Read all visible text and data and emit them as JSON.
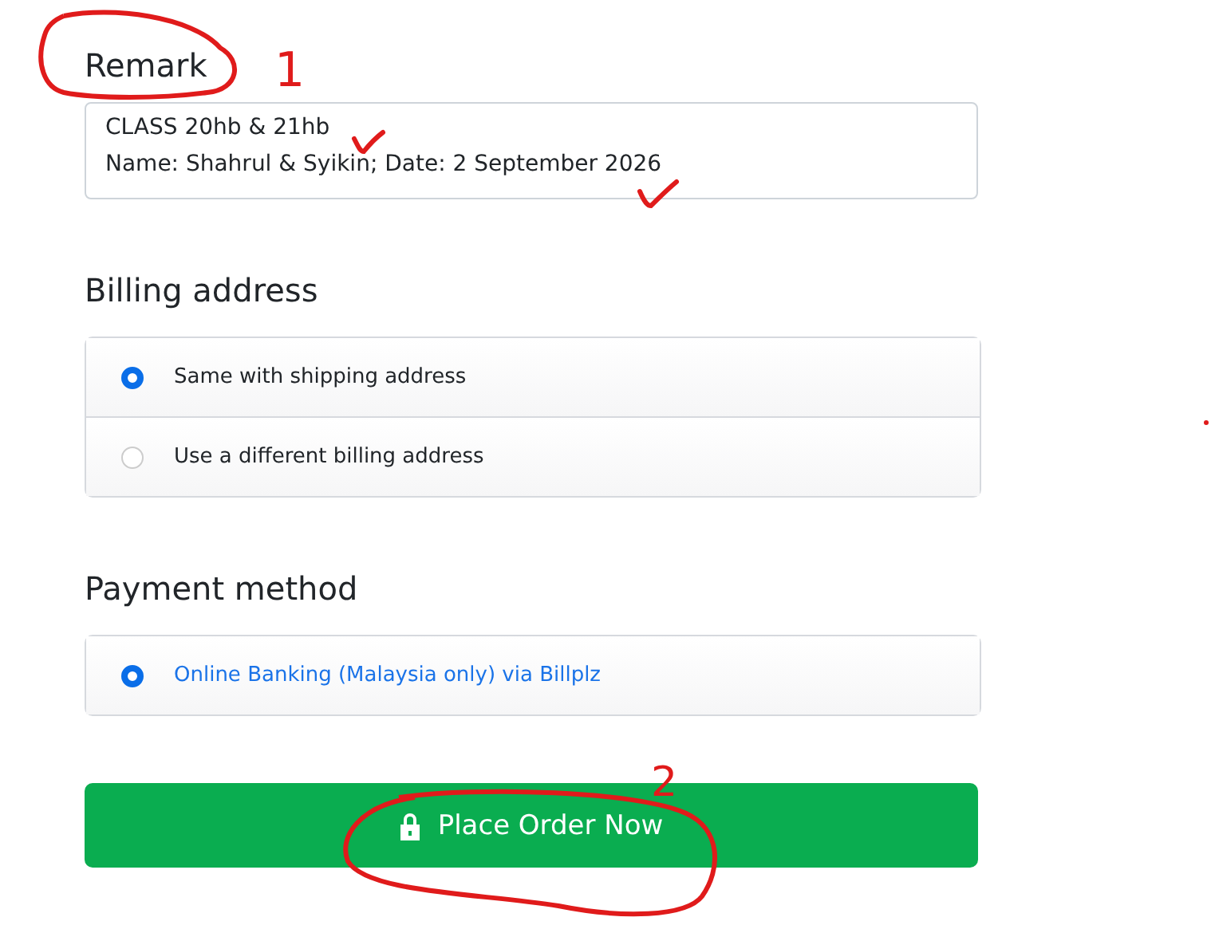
{
  "remark": {
    "title": "Remark",
    "value": "CLASS 20hb & 21hb\nName: Shahrul & Syikin; Date: 2 September 2026"
  },
  "billing": {
    "title": "Billing address",
    "options": [
      {
        "label": "Same with shipping address",
        "selected": true
      },
      {
        "label": "Use a different billing address",
        "selected": false
      }
    ]
  },
  "payment": {
    "title": "Payment method",
    "options": [
      {
        "label": "Online Banking (Malaysia only) via Billplz",
        "selected": true
      }
    ]
  },
  "submit": {
    "label": "Place Order Now"
  },
  "annotations": [
    {
      "label": "1"
    },
    {
      "label": "2"
    }
  ]
}
